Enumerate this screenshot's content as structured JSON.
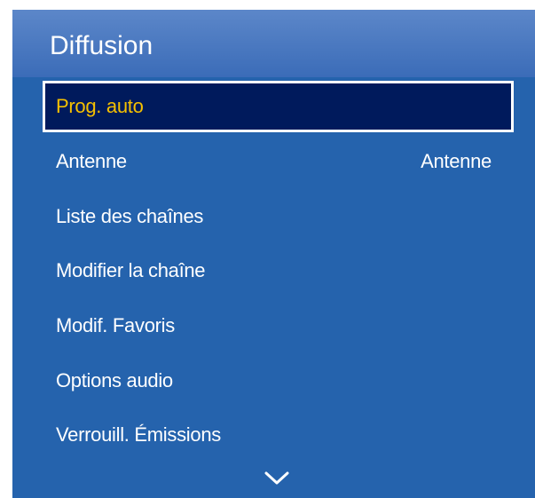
{
  "menu": {
    "title": "Diffusion",
    "items": [
      {
        "label": "Prog. auto",
        "value": "",
        "selected": true
      },
      {
        "label": "Antenne",
        "value": "Antenne",
        "selected": false
      },
      {
        "label": "Liste des chaînes",
        "value": "",
        "selected": false
      },
      {
        "label": "Modifier la chaîne",
        "value": "",
        "selected": false
      },
      {
        "label": "Modif. Favoris",
        "value": "",
        "selected": false
      },
      {
        "label": "Options audio",
        "value": "",
        "selected": false
      },
      {
        "label": "Verrouill. Émissions",
        "value": "",
        "selected": false
      }
    ],
    "scroll_icon": "chevron-down-icon"
  },
  "colors": {
    "panel_background": "#2563ad",
    "header_background": "#4a7bc2",
    "selected_background": "#001a5c",
    "selected_text": "#f5c000",
    "text": "#ffffff"
  }
}
